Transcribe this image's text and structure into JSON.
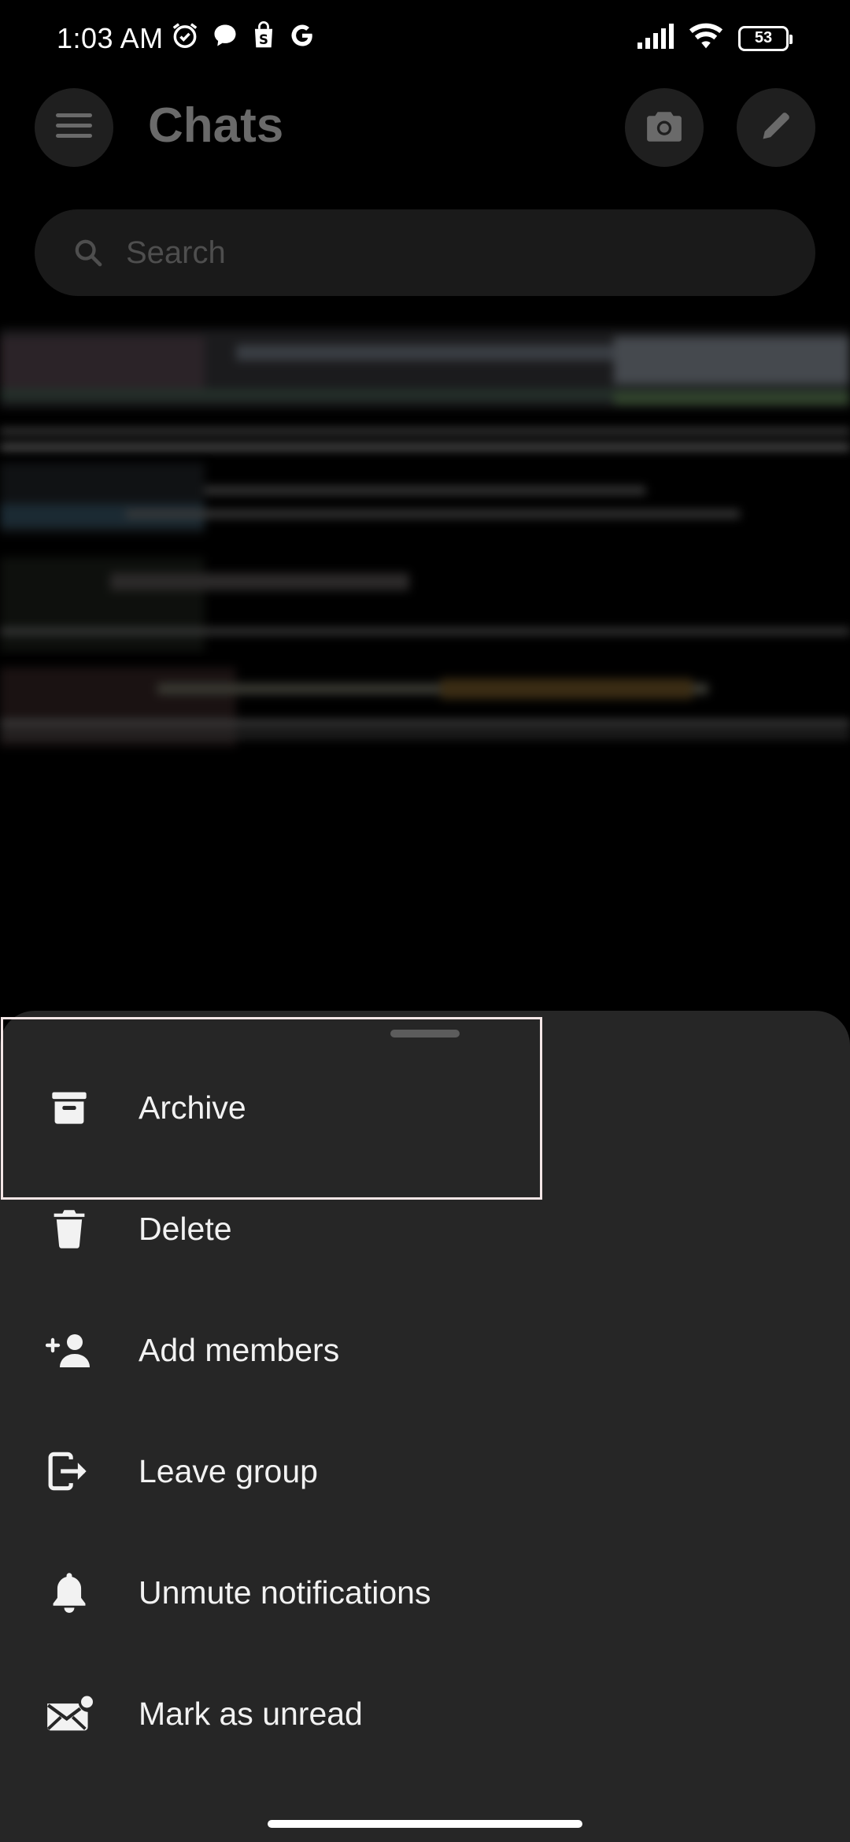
{
  "status_bar": {
    "time": "1:03 AM",
    "battery": "53",
    "left_icons": [
      "alarm-icon",
      "chat-bubble-icon",
      "shopping-bag-icon",
      "google-icon"
    ],
    "right_icons": [
      "signal-icon",
      "wifi-icon",
      "battery-icon"
    ]
  },
  "header": {
    "title": "Chats",
    "menu_icon": "hamburger-menu-icon",
    "camera_icon": "camera-icon",
    "compose_icon": "pencil-icon"
  },
  "search": {
    "placeholder": "Search"
  },
  "sheet": {
    "items": [
      {
        "label": "Archive",
        "icon": "archive-icon"
      },
      {
        "label": "Delete",
        "icon": "trash-icon"
      },
      {
        "label": "Add members",
        "icon": "add-person-icon"
      },
      {
        "label": "Leave group",
        "icon": "leave-icon"
      },
      {
        "label": "Unmute notifications",
        "icon": "bell-icon"
      },
      {
        "label": "Mark as unread",
        "icon": "mail-unread-icon"
      }
    ]
  },
  "colors": {
    "background": "#000000",
    "sheet": "#262626",
    "title_dim": "#6a6a6a",
    "focus_outline": "#f4e6e6"
  }
}
